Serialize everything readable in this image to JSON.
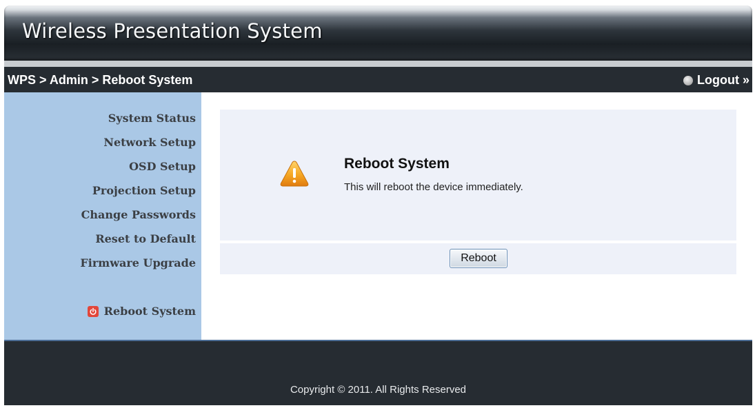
{
  "app": {
    "title": "Wireless Presentation System"
  },
  "nav": {
    "breadcrumb": "WPS > Admin > Reboot System",
    "logout_label": "Logout »"
  },
  "sidebar": {
    "items": [
      {
        "label": "System Status"
      },
      {
        "label": "Network Setup"
      },
      {
        "label": "OSD Setup"
      },
      {
        "label": "Projection Setup"
      },
      {
        "label": "Change Passwords"
      },
      {
        "label": "Reset to Default"
      },
      {
        "label": "Firmware Upgrade"
      },
      {
        "label": "Reboot System",
        "active": true,
        "icon": "power-icon"
      }
    ]
  },
  "panel": {
    "icon": "warning-icon",
    "title": "Reboot System",
    "message": "This will reboot the device immediately.",
    "button_label": "Reboot"
  },
  "footer": {
    "copyright": "Copyright © 2011. All Rights Reserved"
  },
  "colors": {
    "sidebar_bg": "#aac8e6",
    "panel_bg": "#eef1f9",
    "nav_bg": "#262c32",
    "warning": "#f5a623",
    "power_icon": "#e2463a"
  }
}
